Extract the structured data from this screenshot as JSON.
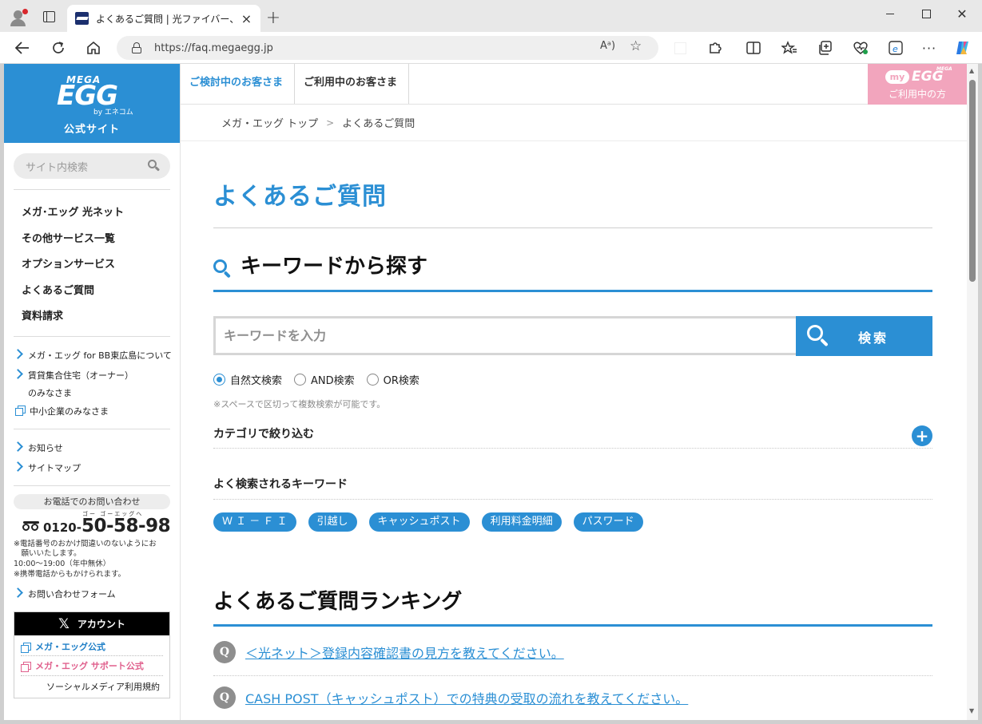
{
  "browser": {
    "tab_title": "よくあるご質問 | 光ファイバー、インター",
    "tab_close": "×",
    "new_tab": "+",
    "url": "https://faq.megaegg.jp",
    "read_aloud": "Á)",
    "win_close": "✕"
  },
  "sidebar": {
    "logo_mega": "MEGA",
    "logo_egg": "EGG",
    "logo_by": "by エネコム",
    "logo_official": "公式サイト",
    "search_placeholder": "サイト内検索",
    "main_links": [
      "メガ･エッグ 光ネット",
      "その他サービス一覧",
      "オプションサービス",
      "よくあるご質問",
      "資料請求"
    ],
    "sub_links": [
      "メガ・エッグ for BB東広島について",
      "賃貸集合住宅（オーナー）",
      "のみなさま",
      "中小企業のみなさま"
    ],
    "info_links": [
      "お知らせ",
      "サイトマップ"
    ],
    "phone": {
      "heading": "お電話でのお問い合わせ",
      "ruby": "ゴー ゴーエッグヘ",
      "prefix": "0120-",
      "number": "50-58-98",
      "note1": "※電話番号のおかけ間違いのないようにお",
      "note2": "　願いいたします。",
      "hours": "10:00～19:00（年中無休）",
      "note3": "※携帯電話からもかけられます。"
    },
    "contact_form": "お問い合わせフォーム",
    "x_account": {
      "logo": "𝕏",
      "title": "アカウント",
      "official": "メガ・エッグ公式",
      "support": "メガ・エッグ サポート公式",
      "policy": "ソーシャルメディア利用規約"
    }
  },
  "topnav": {
    "prospect": "ご検討中のお客さま",
    "customer": "ご利用中のお客さま",
    "myegg_my": "my",
    "myegg_egg": "EGG",
    "myegg_mega": "MEGA",
    "myegg_label": "ご利用中の方"
  },
  "breadcrumb": {
    "home": "メガ・エッグ トップ",
    "sep": ">",
    "current": "よくあるご質問"
  },
  "main": {
    "title": "よくあるご質問",
    "keyword_heading": "キーワードから探す",
    "keyword_placeholder": "キーワードを入力",
    "search_button": "検索",
    "search_modes": [
      "自然文検索",
      "AND検索",
      "OR検索"
    ],
    "selected_mode": "自然文検索",
    "hint": "※スペースで区切って複数検索が可能です。",
    "category_label": "カテゴリで絞り込む",
    "category_toggle": "+",
    "popular_label": "よく検索されるキーワード",
    "popular_keywords": [
      "Ｗ Ｉ － Ｆ Ｉ",
      "引越し",
      "キャッシュポスト",
      "利用料金明細",
      "パスワード"
    ],
    "ranking_heading": "よくあるご質問ランキング",
    "ranking_badge": "Q",
    "ranking": [
      "＜光ネット＞登録内容確認書の見方を教えてください。",
      "CASH POST（キャッシュポスト）での特典の受取の流れを教えてください。"
    ]
  }
}
